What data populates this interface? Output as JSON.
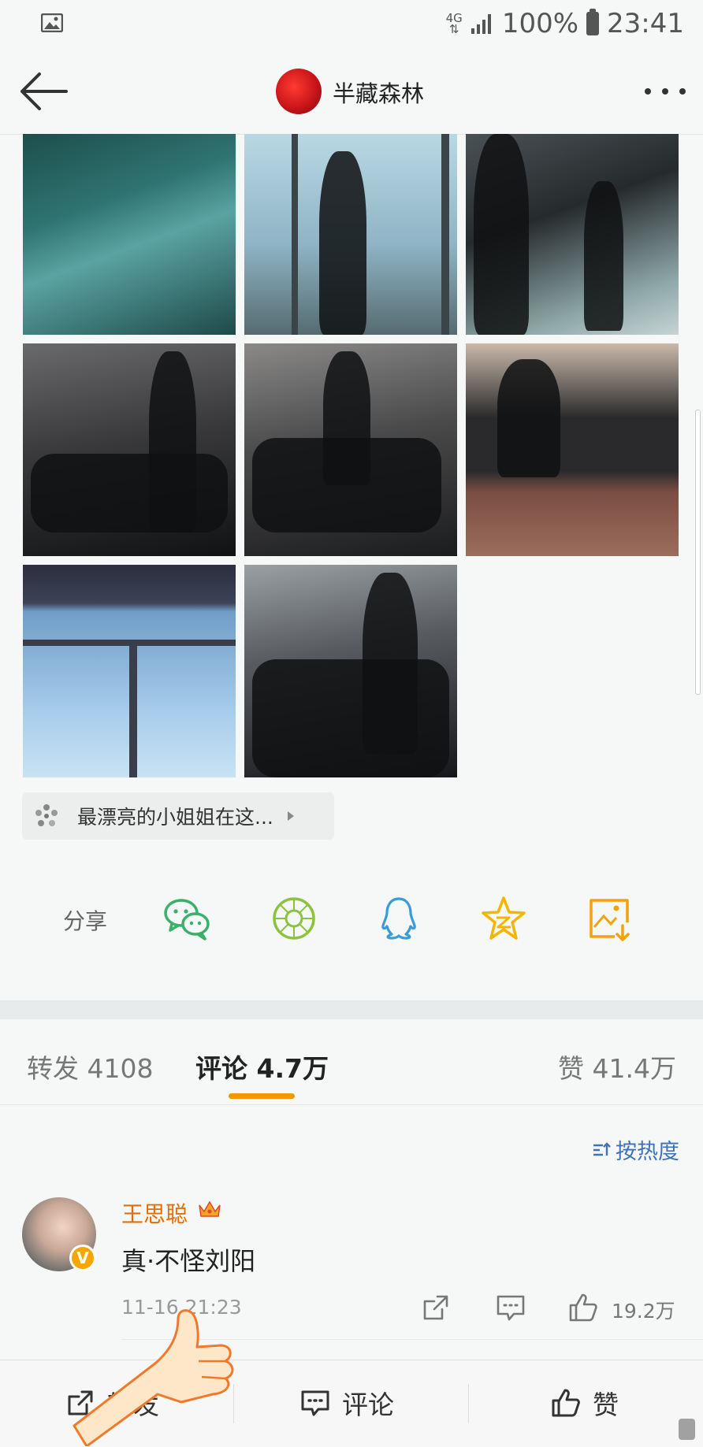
{
  "status_bar": {
    "network": "4G",
    "battery": "100%",
    "time": "23:41"
  },
  "nav": {
    "title": "半藏森林"
  },
  "topic": {
    "text": "最漂亮的小姐姐在这..."
  },
  "share": {
    "label": "分享",
    "icons": [
      "wechat-icon",
      "moments-icon",
      "qq-icon",
      "qzone-icon",
      "save-image-icon"
    ]
  },
  "tabs": [
    {
      "label": "转发 4108",
      "active": false
    },
    {
      "label": "评论 4.7万",
      "active": true
    },
    {
      "label": "赞 41.4万",
      "active": false
    }
  ],
  "sort": {
    "label": "按热度"
  },
  "comment": {
    "username": "王思聪",
    "badge": "V",
    "text": "真·不怪刘阳",
    "time": "11-16 21:23",
    "like_count": "19.2万"
  },
  "bottom_bar": {
    "repost_label": "转发",
    "comment_label": "评论",
    "like_label": "赞"
  },
  "colors": {
    "accent_orange": "#f39800",
    "username_orange": "#e86d00",
    "link_blue": "#3e73b6",
    "background": "#f6f7f7"
  }
}
